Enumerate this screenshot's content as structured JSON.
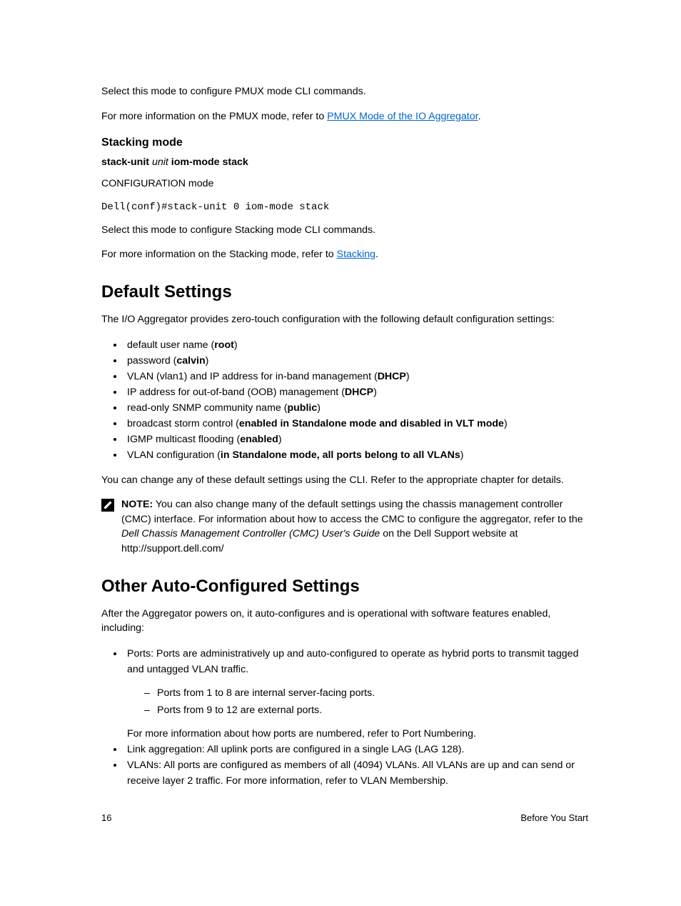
{
  "intro": {
    "p1": "Select this mode to configure PMUX mode CLI commands.",
    "p2_pre": "For more information on the PMUX mode, refer to ",
    "p2_link": "PMUX Mode of the IO Aggregator",
    "p2_post": "."
  },
  "stacking": {
    "heading": "Stacking mode",
    "cmd_pre": "stack-unit ",
    "cmd_ital": "unit",
    "cmd_post": " iom-mode stack",
    "mode": "CONFIGURATION mode",
    "code": "Dell(conf)#stack-unit 0 iom-mode stack",
    "p1": "Select this mode to configure Stacking mode CLI commands.",
    "p2_pre": "For more information on the Stacking mode, refer to ",
    "p2_link": "Stacking",
    "p2_post": "."
  },
  "defaults": {
    "heading": "Default Settings",
    "intro": "The I/O Aggregator provides zero-touch configuration with the following default configuration settings:",
    "items": [
      {
        "pre": "default user name (",
        "bold": "root",
        "post": ")"
      },
      {
        "pre": "password (",
        "bold": "calvin",
        "post": ")"
      },
      {
        "pre": "VLAN (vlan1) and IP address for in-band management (",
        "bold": "DHCP",
        "post": ")"
      },
      {
        "pre": "IP address for out-of-band (OOB) management (",
        "bold": "DHCP",
        "post": ")"
      },
      {
        "pre": "read-only SNMP community name (",
        "bold": "public",
        "post": ")"
      },
      {
        "pre": "broadcast storm control (",
        "bold": "enabled in Standalone mode and disabled in VLT mode",
        "post": ")"
      },
      {
        "pre": "IGMP multicast flooding (",
        "bold": "enabled",
        "post": ")"
      },
      {
        "pre": "VLAN configuration (",
        "bold": "in Standalone mode, all ports belong to all VLANs",
        "post": ")"
      }
    ],
    "after": "You can change any of these default settings using the CLI. Refer to the appropriate chapter for details.",
    "note_label": "NOTE:",
    "note_1": " You can also change many of the default settings using the chassis management controller (CMC) interface. For information about how to access the CMC to configure the aggregator, refer to the ",
    "note_ital": "Dell Chassis Management Controller (CMC) User's Guide",
    "note_2": " on the Dell Support website at http://support.dell.com/"
  },
  "other": {
    "heading": "Other Auto-Configured Settings",
    "intro": "After the Aggregator powers on, it auto-configures and is operational with software features enabled, including:",
    "li1": "Ports: Ports are administratively up and auto-configured to operate as hybrid ports to transmit tagged and untagged VLAN traffic.",
    "li1_sub1": "Ports from 1 to 8 are internal server-facing ports.",
    "li1_sub2": "Ports from 9 to 12 are external ports.",
    "li1_after": "For more information about how ports are numbered, refer to Port Numbering.",
    "li2": "Link aggregation: All uplink ports are configured in a single LAG (LAG 128).",
    "li3": "VLANs: All ports are configured as members of all (4094) VLANs. All VLANs are up and can send or receive layer 2 traffic. For more information, refer to VLAN Membership."
  },
  "footer": {
    "page": "16",
    "title": "Before You Start"
  }
}
